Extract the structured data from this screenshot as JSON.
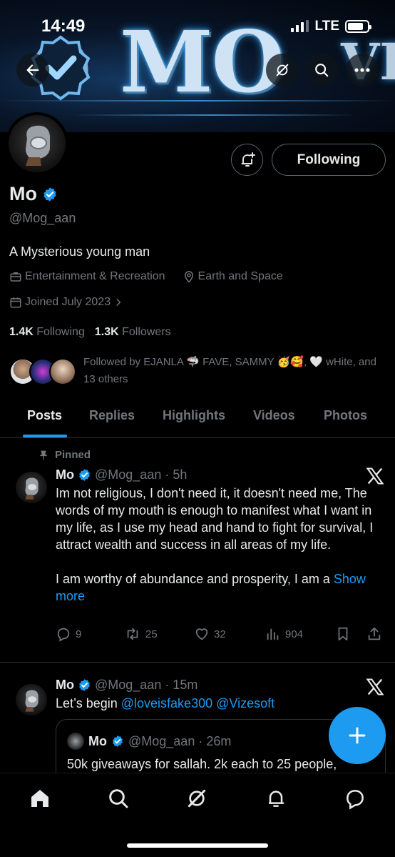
{
  "status_bar": {
    "time": "14:49",
    "network": "LTE",
    "battery_level": 0.8
  },
  "banner": {
    "text": "MO",
    "text_partial": "VE"
  },
  "profile": {
    "name": "Mo",
    "handle": "@Mog_aan",
    "bio": "A Mysterious young man",
    "category": "Entertainment & Recreation",
    "location": "Earth and Space",
    "joined": "Joined July 2023",
    "following_count": "1.4K",
    "following_label": "Following",
    "followers_count": "1.3K",
    "followers_label": "Followers",
    "followed_by": "Followed by EJANLA 🦈 FAVE, SAMMY 🥳🥰, 🤍 wHite, and 13 others",
    "follow_button_label": "Following"
  },
  "tabs": [
    {
      "label": "Posts",
      "active": true
    },
    {
      "label": "Replies",
      "active": false
    },
    {
      "label": "Highlights",
      "active": false
    },
    {
      "label": "Videos",
      "active": false
    },
    {
      "label": "Photos",
      "active": false
    }
  ],
  "posts": [
    {
      "pinned_label": "Pinned",
      "name": "Mo",
      "handle_time": "@Mog_aan · 5h",
      "body_p1": "Im not religious, I don't need it, it doesn't need me, The words of my mouth is enough to manifest what I want in my life, as I use my head and hand to fight for survival, I attract wealth and success in all areas of my life.",
      "body_p2": "I am worthy of abundance and prosperity, I am a ",
      "show_more": "Show more",
      "replies": "9",
      "reposts": "25",
      "likes": "32",
      "views": "904"
    },
    {
      "name": "Mo",
      "handle_time": "@Mog_aan · 15m",
      "body_prefix": "Let’s begin ",
      "mention1": "@loveisfake300",
      "mention2": "@Vizesoft",
      "quote": {
        "name": "Mo",
        "handle_time": "@Mog_aan · 26m",
        "body": "50k giveaways for sallah. 2k each to 25 people,"
      }
    }
  ],
  "icons": {
    "back": "back-arrow-icon",
    "grok": "grok-icon",
    "search": "search-icon",
    "more": "more-icon",
    "notify": "bell-plus-icon",
    "verified": "verified-badge-icon",
    "x_logo": "x-logo-icon"
  },
  "colors": {
    "accent": "#1d9bf0",
    "muted": "#71767b",
    "text": "#e7e9ea",
    "border": "#2f3336"
  }
}
